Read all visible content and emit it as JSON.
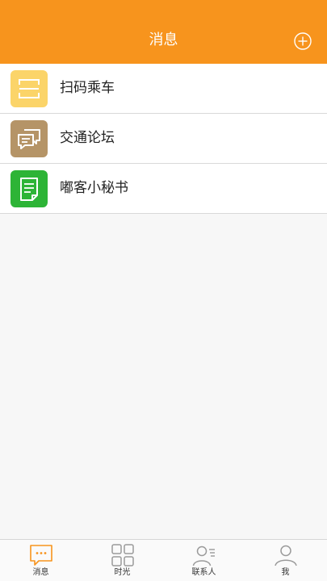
{
  "header": {
    "title": "消息"
  },
  "list": [
    {
      "label": "扫码乘车",
      "icon": "scan-icon",
      "icon_color": "#fbd469"
    },
    {
      "label": "交通论坛",
      "icon": "chat-bubbles-icon",
      "icon_color": "#b59467"
    },
    {
      "label": "嘟客小秘书",
      "icon": "document-icon",
      "icon_color": "#2db436"
    }
  ],
  "tabs": [
    {
      "label": "消息",
      "icon": "message-icon",
      "active": true
    },
    {
      "label": "时光",
      "icon": "grid-icon",
      "active": false
    },
    {
      "label": "联系人",
      "icon": "contacts-icon",
      "active": false
    },
    {
      "label": "我",
      "icon": "user-icon",
      "active": false
    }
  ],
  "colors": {
    "accent": "#f7941d",
    "inactive_icon": "#9a9a9a"
  }
}
